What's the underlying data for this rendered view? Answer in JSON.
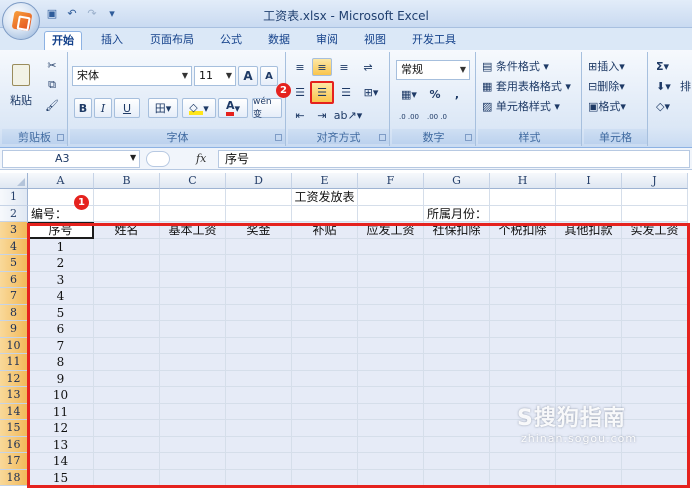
{
  "window": {
    "title": "工资表.xlsx - Microsoft Excel"
  },
  "tabs": [
    "开始",
    "插入",
    "页面布局",
    "公式",
    "数据",
    "审阅",
    "视图",
    "开发工具"
  ],
  "clipboard": {
    "paste": "粘贴",
    "label": "剪贴板"
  },
  "font": {
    "name": "宋体",
    "size": "11",
    "grow": "A",
    "shrink": "A",
    "bold": "B",
    "italic": "I",
    "underline": "U",
    "phonetic": "wén 变",
    "label": "字体",
    "font_color": "#e5221e",
    "fill_color": "#ffe51a"
  },
  "alignment": {
    "label": "对齐方式"
  },
  "number": {
    "format": "常规",
    "percent": "%",
    "comma": ",",
    "inc_decimal": ".0 .00",
    "dec_decimal": ".00 .0",
    "label": "数字"
  },
  "styles": {
    "conditional": "条件格式",
    "table": "套用表格格式",
    "cell": "单元格样式",
    "label": "样式"
  },
  "cells": {
    "insert": "插入",
    "delete": "删除",
    "format": "格式",
    "label": "单元格"
  },
  "editing": {
    "sum": "Σ",
    "sort": "排"
  },
  "formula_bar": {
    "name_box": "A3",
    "fx": "fx",
    "content": "序号"
  },
  "markers": {
    "m1": "1",
    "m2": "2"
  },
  "columns": [
    "A",
    "B",
    "C",
    "D",
    "E",
    "F",
    "G",
    "H",
    "I",
    "J"
  ],
  "rows": [
    "1",
    "2",
    "3",
    "4",
    "5",
    "6",
    "7",
    "8",
    "9",
    "10",
    "11",
    "12",
    "13",
    "14",
    "15",
    "16",
    "17",
    "18"
  ],
  "sheet": {
    "title": "工资发放表",
    "code_label": "编号：",
    "month_label": "所属月份：",
    "headers": [
      "序号",
      "姓名",
      "基本工资",
      "奖金",
      "补贴",
      "应发工资",
      "社保扣除",
      "个税扣除",
      "其他扣款",
      "实发工资"
    ],
    "serial": [
      "1",
      "2",
      "3",
      "4",
      "5",
      "6",
      "7",
      "8",
      "9",
      "10",
      "11",
      "12",
      "13",
      "14",
      "15"
    ]
  },
  "watermark": {
    "brand": "S搜狗指南",
    "url": "zhinan.sogou.com"
  }
}
